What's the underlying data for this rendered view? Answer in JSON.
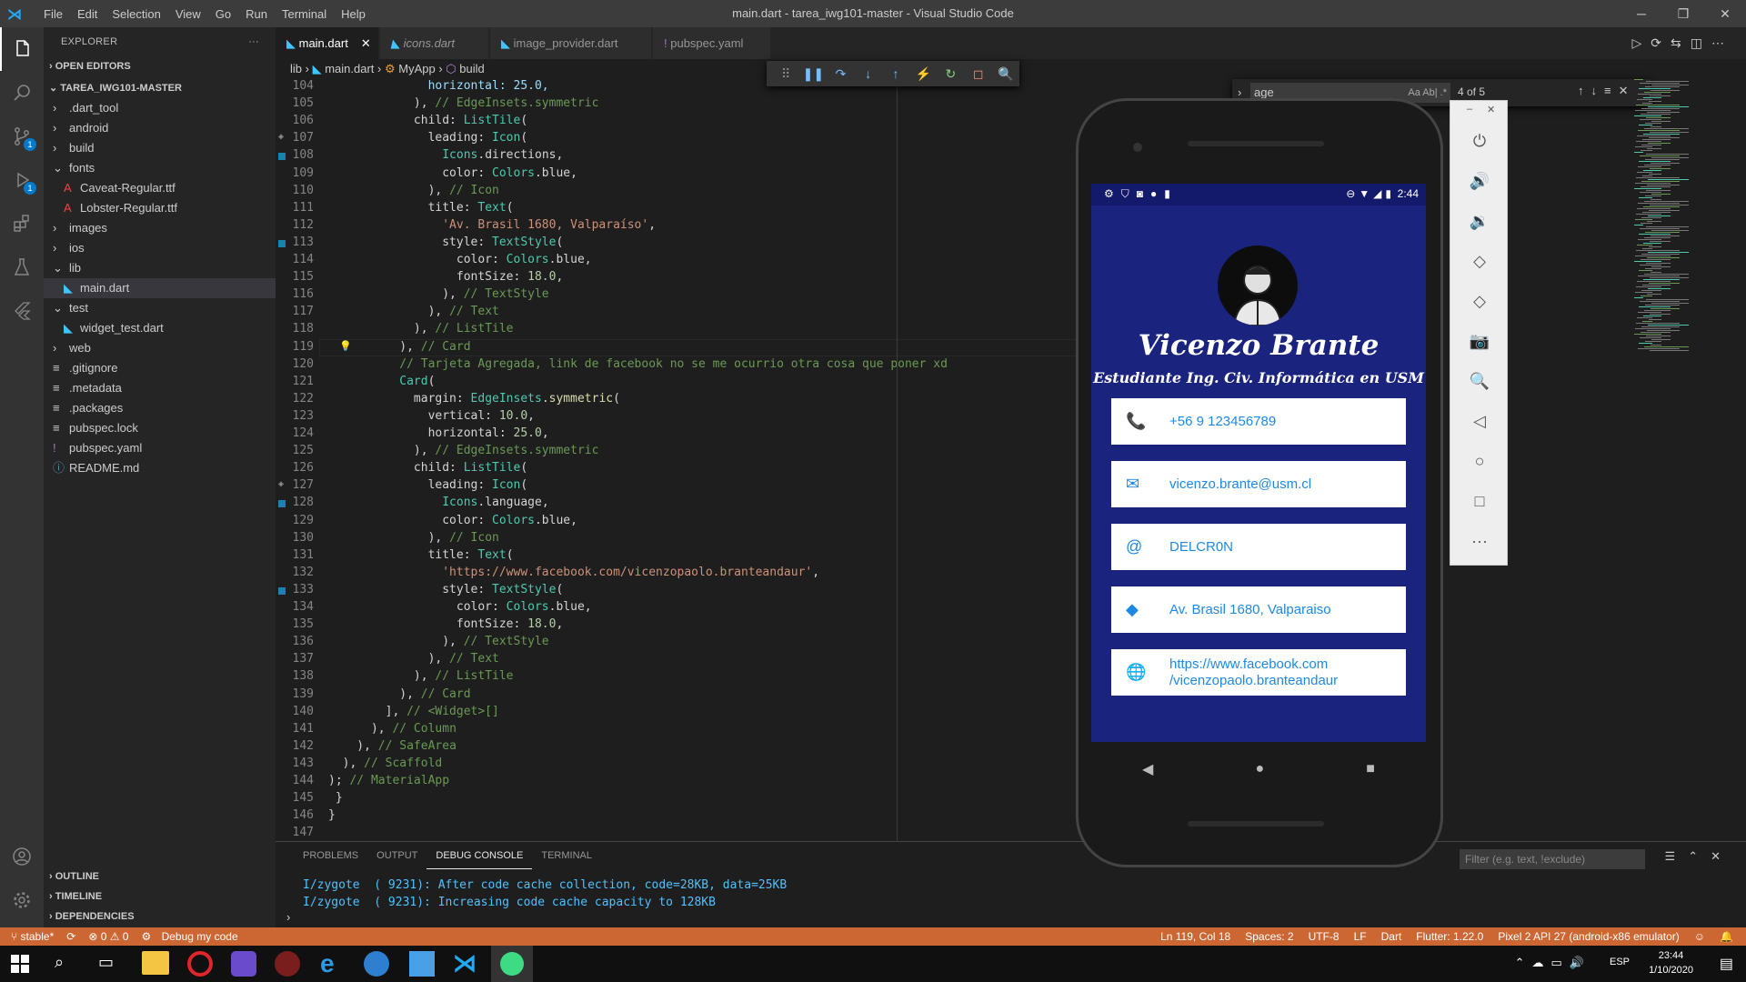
{
  "window": {
    "title": "main.dart - tarea_iwg101-master - Visual Studio Code",
    "menu": [
      "File",
      "Edit",
      "Selection",
      "View",
      "Go",
      "Run",
      "Terminal",
      "Help"
    ],
    "controls": [
      "─",
      "❐",
      "✕"
    ]
  },
  "activity": {
    "badge_scm": "1",
    "badge_debug": "1"
  },
  "explorer": {
    "header": "EXPLORER",
    "more": "···",
    "open_editors": "OPEN EDITORS",
    "project": "TAREA_IWG101-MASTER",
    "items": [
      {
        "label": ".dart_tool",
        "indent": 1,
        "icon": "›"
      },
      {
        "label": "android",
        "indent": 1,
        "icon": "›"
      },
      {
        "label": "build",
        "indent": 1,
        "icon": "›"
      },
      {
        "label": "fonts",
        "indent": 1,
        "icon": "⌄"
      },
      {
        "label": "Caveat-Regular.ttf",
        "indent": 2,
        "icon": "A"
      },
      {
        "label": "Lobster-Regular.ttf",
        "indent": 2,
        "icon": "A"
      },
      {
        "label": "images",
        "indent": 1,
        "icon": "›"
      },
      {
        "label": "ios",
        "indent": 1,
        "icon": "›"
      },
      {
        "label": "lib",
        "indent": 1,
        "icon": "⌄"
      },
      {
        "label": "main.dart",
        "indent": 2,
        "icon": "◣",
        "selected": true
      },
      {
        "label": "test",
        "indent": 1,
        "icon": "⌄"
      },
      {
        "label": "widget_test.dart",
        "indent": 2,
        "icon": "◣"
      },
      {
        "label": "web",
        "indent": 1,
        "icon": "›"
      },
      {
        "label": ".gitignore",
        "indent": 1,
        "icon": "≡"
      },
      {
        "label": ".metadata",
        "indent": 1,
        "icon": "≡"
      },
      {
        "label": ".packages",
        "indent": 1,
        "icon": "≡"
      },
      {
        "label": "pubspec.lock",
        "indent": 1,
        "icon": "≡"
      },
      {
        "label": "pubspec.yaml",
        "indent": 1,
        "icon": "!"
      },
      {
        "label": "README.md",
        "indent": 1,
        "icon": "ⓘ"
      }
    ],
    "bottom_sections": [
      "OUTLINE",
      "TIMELINE",
      "DEPENDENCIES"
    ]
  },
  "tabs": [
    {
      "label": "main.dart",
      "active": true,
      "close": "✕"
    },
    {
      "label": "icons.dart"
    },
    {
      "label": "image_provider.dart"
    },
    {
      "label": "pubspec.yaml"
    }
  ],
  "breadcrumb": [
    "lib",
    "main.dart",
    "MyApp",
    "build"
  ],
  "find": {
    "query": "age",
    "result": "4 of 5",
    "opts": "Aa  Ab|  .*"
  },
  "code": {
    "start": 104,
    "lines": [
      [
        {
          "t": "              horizontal: 25.0,",
          "c": "pr"
        }
      ],
      [
        {
          "t": "            ), "
        },
        {
          "t": "// EdgeInsets.symmetric",
          "c": "cm"
        }
      ],
      [
        {
          "t": "            child: "
        },
        {
          "t": "ListTile",
          "c": "ty"
        },
        {
          "t": "("
        }
      ],
      [
        {
          "t": "              leading: "
        },
        {
          "t": "Icon",
          "c": "ty"
        },
        {
          "t": "("
        }
      ],
      [
        {
          "t": "                "
        },
        {
          "t": "Icons",
          "c": "ty"
        },
        {
          "t": ".directions,"
        }
      ],
      [
        {
          "t": "                color: "
        },
        {
          "t": "Colors",
          "c": "ty"
        },
        {
          "t": ".blue,"
        }
      ],
      [
        {
          "t": "              ), "
        },
        {
          "t": "// Icon",
          "c": "cm"
        }
      ],
      [
        {
          "t": "              title: "
        },
        {
          "t": "Text",
          "c": "ty"
        },
        {
          "t": "("
        }
      ],
      [
        {
          "t": "                "
        },
        {
          "t": "'Av. Brasil 1680, Valparaíso'",
          "c": "st"
        },
        {
          "t": ","
        }
      ],
      [
        {
          "t": "                style: "
        },
        {
          "t": "TextStyle",
          "c": "ty"
        },
        {
          "t": "("
        }
      ],
      [
        {
          "t": "                  color: "
        },
        {
          "t": "Colors",
          "c": "ty"
        },
        {
          "t": ".blue,"
        }
      ],
      [
        {
          "t": "                  fontSize: "
        },
        {
          "t": "18.0",
          "c": "nu"
        },
        {
          "t": ","
        }
      ],
      [
        {
          "t": "                ), "
        },
        {
          "t": "// TextStyle",
          "c": "cm"
        }
      ],
      [
        {
          "t": "              ), "
        },
        {
          "t": "// Text",
          "c": "cm"
        }
      ],
      [
        {
          "t": "            ), "
        },
        {
          "t": "// ListTile",
          "c": "cm"
        }
      ],
      [
        {
          "t": "          ), "
        },
        {
          "t": "// Card",
          "c": "cm"
        }
      ],
      [
        {
          "t": "          "
        },
        {
          "t": "// Tarjeta Agregada, link de facebook no se me ocurrio otra cosa que poner xd",
          "c": "cm"
        }
      ],
      [
        {
          "t": "          "
        },
        {
          "t": "Card",
          "c": "ty"
        },
        {
          "t": "("
        }
      ],
      [
        {
          "t": "            margin: "
        },
        {
          "t": "EdgeInsets",
          "c": "ty"
        },
        {
          "t": "."
        },
        {
          "t": "symmetric",
          "c": "fn"
        },
        {
          "t": "("
        }
      ],
      [
        {
          "t": "              vertical: "
        },
        {
          "t": "10.0",
          "c": "nu"
        },
        {
          "t": ","
        }
      ],
      [
        {
          "t": "              horizontal: "
        },
        {
          "t": "25.0",
          "c": "nu"
        },
        {
          "t": ","
        }
      ],
      [
        {
          "t": "            ), "
        },
        {
          "t": "// EdgeInsets.symmetric",
          "c": "cm"
        }
      ],
      [
        {
          "t": "            child: "
        },
        {
          "t": "ListTile",
          "c": "ty"
        },
        {
          "t": "("
        }
      ],
      [
        {
          "t": "              leading: "
        },
        {
          "t": "Icon",
          "c": "ty"
        },
        {
          "t": "("
        }
      ],
      [
        {
          "t": "                "
        },
        {
          "t": "Icons",
          "c": "ty"
        },
        {
          "t": ".language,"
        }
      ],
      [
        {
          "t": "                color: "
        },
        {
          "t": "Colors",
          "c": "ty"
        },
        {
          "t": ".blue,"
        }
      ],
      [
        {
          "t": "              ), "
        },
        {
          "t": "// Icon",
          "c": "cm"
        }
      ],
      [
        {
          "t": "              title: "
        },
        {
          "t": "Text",
          "c": "ty"
        },
        {
          "t": "("
        }
      ],
      [
        {
          "t": "                "
        },
        {
          "t": "'https://www.facebook.com/vicenzopaolo.branteandaur'",
          "c": "st"
        },
        {
          "t": ","
        }
      ],
      [
        {
          "t": "                style: "
        },
        {
          "t": "TextStyle",
          "c": "ty"
        },
        {
          "t": "("
        }
      ],
      [
        {
          "t": "                  color: "
        },
        {
          "t": "Colors",
          "c": "ty"
        },
        {
          "t": ".blue,"
        }
      ],
      [
        {
          "t": "                  fontSize: "
        },
        {
          "t": "18.0",
          "c": "nu"
        },
        {
          "t": ","
        }
      ],
      [
        {
          "t": "                ), "
        },
        {
          "t": "// TextStyle",
          "c": "cm"
        }
      ],
      [
        {
          "t": "              ), "
        },
        {
          "t": "// Text",
          "c": "cm"
        }
      ],
      [
        {
          "t": "            ), "
        },
        {
          "t": "// ListTile",
          "c": "cm"
        }
      ],
      [
        {
          "t": "          ), "
        },
        {
          "t": "// Card",
          "c": "cm"
        }
      ],
      [
        {
          "t": "        ], "
        },
        {
          "t": "// <Widget>[]",
          "c": "cm"
        }
      ],
      [
        {
          "t": "      ), "
        },
        {
          "t": "// Column",
          "c": "cm"
        }
      ],
      [
        {
          "t": "    ), "
        },
        {
          "t": "// SafeArea",
          "c": "cm"
        }
      ],
      [
        {
          "t": "  ), "
        },
        {
          "t": "// Scaffold",
          "c": "cm"
        }
      ],
      [
        {
          "t": "); "
        },
        {
          "t": "// MaterialApp",
          "c": "cm"
        }
      ],
      [
        {
          "t": " }"
        }
      ],
      [
        {
          "t": "}"
        }
      ],
      [
        {
          "t": ""
        }
      ]
    ]
  },
  "panel": {
    "tabs": [
      "PROBLEMS",
      "OUTPUT",
      "DEBUG CONSOLE",
      "TERMINAL"
    ],
    "active": "DEBUG CONSOLE",
    "filter_placeholder": "Filter (e.g. text, !exclude)",
    "lines": [
      "I/zygote  ( 9231): After code cache collection, code=28KB, data=25KB",
      "I/zygote  ( 9231): Increasing code cache capacity to 128KB"
    ],
    "prompt": "›"
  },
  "status": {
    "branch": "stable*",
    "errors": "⊗ 0 ⚠ 0",
    "debug": "Debug my code",
    "ln": "Ln 119, Col 18",
    "spaces": "Spaces: 2",
    "enc": "UTF-8",
    "eol": "LF",
    "lang": "Dart",
    "flutter": "Flutter: 1.22.0",
    "device": "Pixel 2 API 27 (android-x86 emulator)"
  },
  "app": {
    "time": "2:44",
    "name": "Vicenzo Brante",
    "subtitle": "Estudiante Ing. Civ. Informática en USM",
    "cards": [
      {
        "icon": "📞",
        "text": "+56 9 123456789"
      },
      {
        "icon": "✉",
        "text": "vicenzo.brante@usm.cl"
      },
      {
        "icon": "@",
        "text": "DELCR0N"
      },
      {
        "icon": "◆",
        "text": "Av. Brasil 1680, Valparaiso"
      },
      {
        "icon": "🌐",
        "text": "https://www.facebook.com\n/vicenzopaolo.branteandaur"
      }
    ],
    "nav": [
      "◀",
      "●",
      "■"
    ]
  },
  "emulator_controls": [
    "⏻",
    "🔊",
    "🔉",
    "◇",
    "◇",
    "📷",
    "🔍",
    "◁",
    "○",
    "□",
    "···"
  ],
  "taskbar": {
    "lang": "ESP",
    "time": "23:44",
    "date": "1/10/2020"
  },
  "colors": {
    "accent": "#007acc",
    "status": "#cc6633",
    "app_bg": "#1a237e",
    "card_text": "#1e88e5"
  }
}
